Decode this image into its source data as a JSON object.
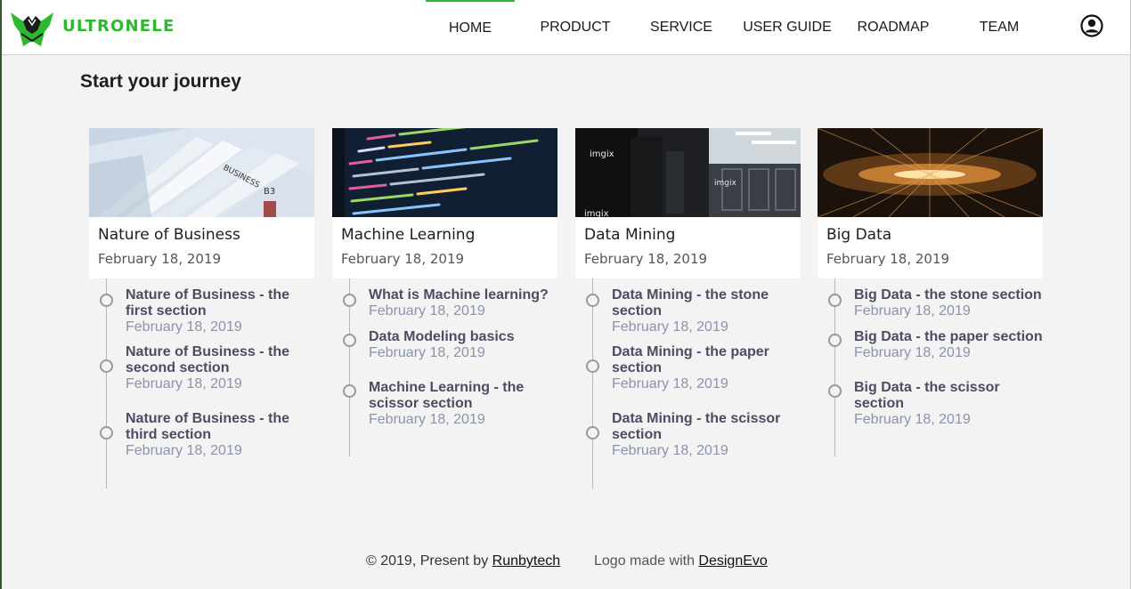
{
  "header": {
    "brand": "ULTRONELE",
    "nav": [
      "HOME",
      "PRODUCT",
      "SERVICE",
      "USER GUIDE",
      "ROADMAP",
      "TEAM"
    ],
    "active_nav": "HOME",
    "brand_color": "#2db82d",
    "account_icon": "account-circle-icon"
  },
  "main": {
    "title": "Start your journey",
    "columns": [
      {
        "title": "Nature of Business",
        "date": "February 18, 2019",
        "sections": [
          {
            "title": "Nature of Business - the first section",
            "date": "February 18, 2019"
          },
          {
            "title": "Nature of Business - the second section",
            "date": "February 18, 2019"
          },
          {
            "title": "Nature of Business - the third section",
            "date": "February 18, 2019"
          }
        ]
      },
      {
        "title": "Machine Learning",
        "date": "February 18, 2019",
        "sections": [
          {
            "title": "What is Machine learning?",
            "date": "February 18, 2019"
          },
          {
            "title": "Data Modeling basics",
            "date": "February 18, 2019"
          },
          {
            "title": "Machine Learning - the scissor section",
            "date": "February 18, 2019"
          }
        ]
      },
      {
        "title": "Data Mining",
        "date": "February 18, 2019",
        "sections": [
          {
            "title": "Data Mining - the stone section",
            "date": "February 18, 2019"
          },
          {
            "title": "Data Mining - the paper section",
            "date": "February 18, 2019"
          },
          {
            "title": "Data Mining - the scissor section",
            "date": "February 18, 2019"
          }
        ]
      },
      {
        "title": "Big Data",
        "date": "February 18, 2019",
        "sections": [
          {
            "title": "Big Data - the stone section",
            "date": "February 18, 2019"
          },
          {
            "title": "Big Data - the paper section",
            "date": "February 18, 2019"
          },
          {
            "title": "Big Data - the scissor section",
            "date": "February 18, 2019"
          }
        ]
      }
    ]
  },
  "footer": {
    "copyright_prefix": "© 2019, Present by",
    "company_link": "Runbytech",
    "logo_prefix": "Logo made with",
    "logo_link": "DesignEvo"
  }
}
